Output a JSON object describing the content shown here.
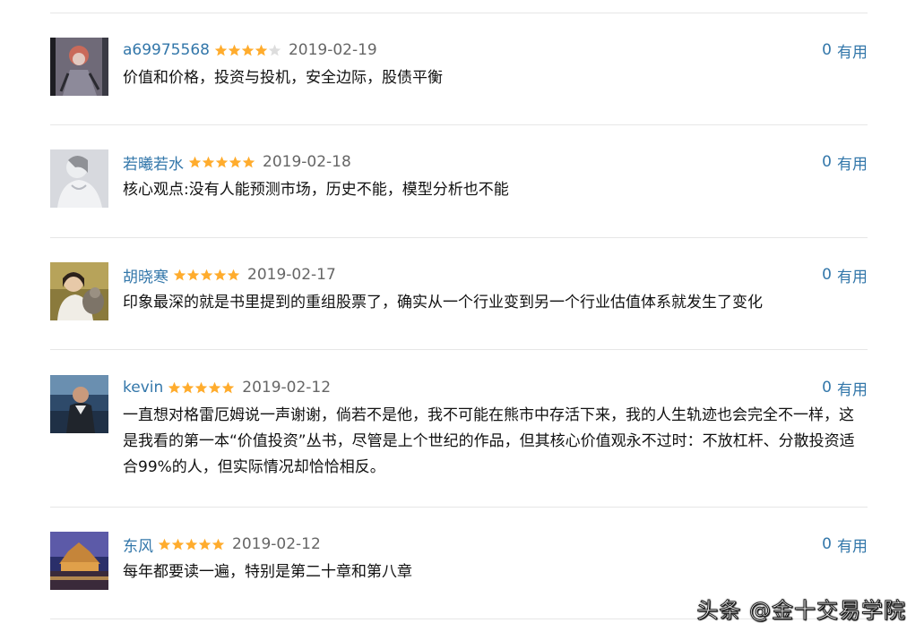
{
  "comments": [
    {
      "username": "a69975568",
      "rating": 4,
      "date": "2019-02-19",
      "votes": "0",
      "vote_label": "有用",
      "text": "价值和价格，投资与投机，安全边际，股债平衡"
    },
    {
      "username": "若曦若水",
      "rating": 5,
      "date": "2019-02-18",
      "votes": "0",
      "vote_label": "有用",
      "text": "核心观点:没有人能预测市场，历史不能，模型分析也不能"
    },
    {
      "username": "胡晓寒",
      "rating": 5,
      "date": "2019-02-17",
      "votes": "0",
      "vote_label": "有用",
      "text": "印象最深的就是书里提到的重组股票了，确实从一个行业变到另一个行业估值体系就发生了变化"
    },
    {
      "username": "kevin",
      "rating": 5,
      "date": "2019-02-12",
      "votes": "0",
      "vote_label": "有用",
      "text": "一直想对格雷厄姆说一声谢谢，倘若不是他，我不可能在熊市中存活下来，我的人生轨迹也会完全不一样，这是我看的第一本“价值投资”丛书，尽管是上个世纪的作品，但其核心价值观永不过时：不放杠杆、分散投资适合99%的人，但实际情况却恰恰相反。"
    },
    {
      "username": "东风",
      "rating": 5,
      "date": "2019-02-12",
      "votes": "0",
      "vote_label": "有用",
      "text": "每年都要读一遍，特别是第二十章和第八章"
    }
  ],
  "colors": {
    "link": "#3377aa",
    "star_filled": "#ffac2d",
    "star_empty": "#dddddd",
    "date": "#666666"
  },
  "watermark": "头条 @金十交易学院"
}
